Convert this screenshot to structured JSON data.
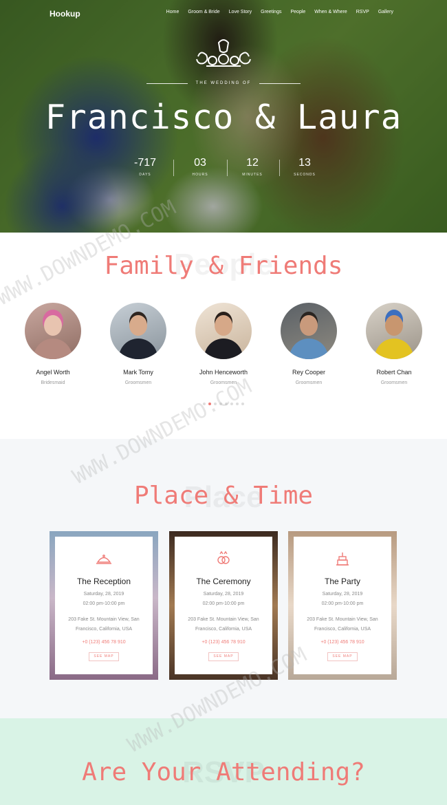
{
  "nav": {
    "brand": "Hookup",
    "items": [
      "Home",
      "Groom & Bride",
      "Love Story",
      "Greetings",
      "People",
      "When & Where",
      "RSVP",
      "Gallery"
    ]
  },
  "hero": {
    "subtitle": "THE WEDDING OF",
    "title": "Francisco & Laura",
    "countdown": [
      {
        "value": "-717",
        "label": "DAYS"
      },
      {
        "value": "03",
        "label": "HOURS"
      },
      {
        "value": "12",
        "label": "MINUTES"
      },
      {
        "value": "13",
        "label": "SECONDS"
      }
    ]
  },
  "family": {
    "ghost": "People",
    "title": "Family & Friends",
    "people": [
      {
        "name": "Angel Worth",
        "role": "Bridesmaid"
      },
      {
        "name": "Mark Tomy",
        "role": "Groomsmen"
      },
      {
        "name": "John Henceworth",
        "role": "Groomsmen"
      },
      {
        "name": "Rey Cooper",
        "role": "Groomsmen"
      },
      {
        "name": "Robert Chan",
        "role": "Groomsmen"
      }
    ],
    "pager_count": 8,
    "pager_active": 1
  },
  "place": {
    "ghost": "Place",
    "title": "Place & Time",
    "events": [
      {
        "title": "The Reception",
        "date": "Saturday, 28, 2019",
        "time": "02:00 pm-10:00 pm",
        "address": "203 Fake St. Mountain View, San Francisco, California, USA",
        "phone": "+0 (123) 456 78 910",
        "map": "SEE MAP",
        "icon": "cloche-icon"
      },
      {
        "title": "The Ceremony",
        "date": "Saturday, 28, 2019",
        "time": "02:00 pm-10:00 pm",
        "address": "203 Fake St. Mountain View, San Francisco, California, USA",
        "phone": "+0 (123) 456 78 910",
        "map": "SEE MAP",
        "icon": "rings-icon"
      },
      {
        "title": "The Party",
        "date": "Saturday, 28, 2019",
        "time": "02:00 pm-10:00 pm",
        "address": "203 Fake St. Mountain View, San Francisco, California, USA",
        "phone": "+0 (123) 456 78 910",
        "map": "SEE MAP",
        "icon": "cake-icon"
      }
    ]
  },
  "rsvp": {
    "ghost": "RSVP",
    "title": "Are Your Attending?"
  },
  "watermark": "WWW.DOWNDEMO.COM",
  "colors": {
    "accent": "#ef7b77",
    "rsvp_bg": "#d9f3e6",
    "place_bg": "#f5f7f9"
  }
}
